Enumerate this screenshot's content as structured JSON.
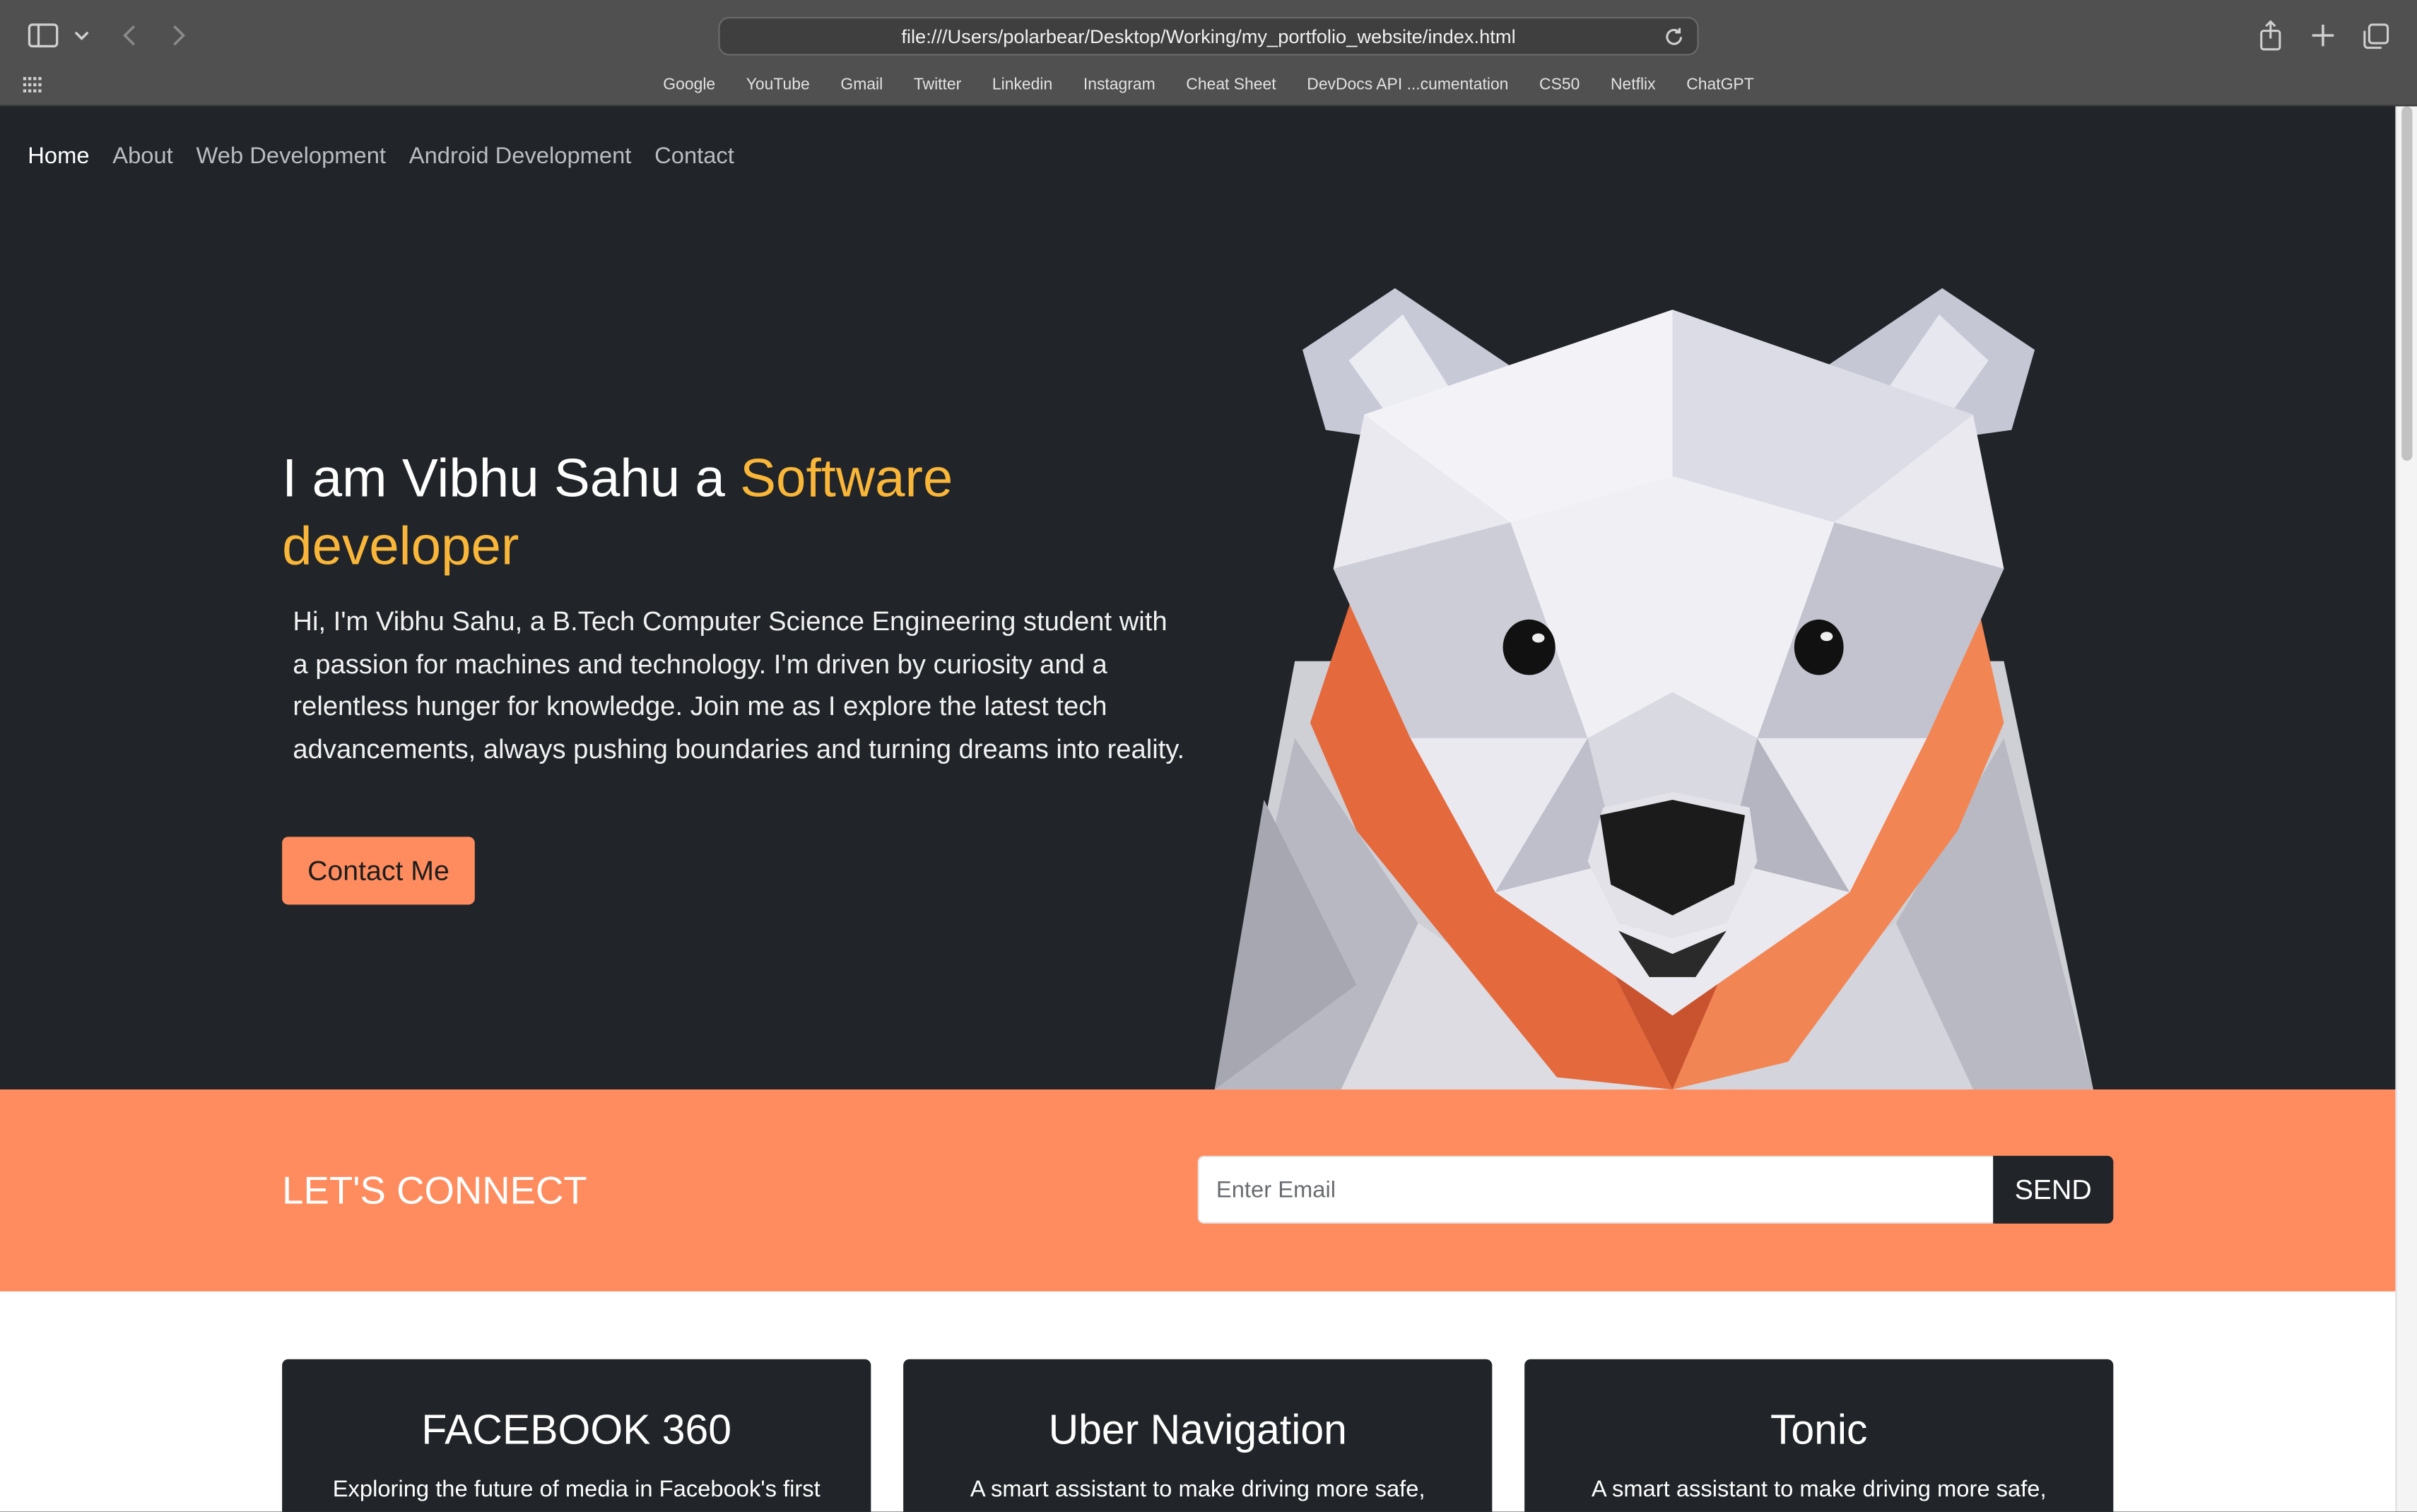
{
  "browser": {
    "url": "file:///Users/polarbear/Desktop/Working/my_portfolio_website/index.html",
    "icons": [
      "sidebar-icon",
      "chevron-down-icon",
      "back-icon",
      "forward-icon",
      "reload-icon",
      "share-icon",
      "plus-icon",
      "tabs-icon",
      "grid-icon"
    ],
    "bookmarks": [
      "Google",
      "YouTube",
      "Gmail",
      "Twitter",
      "Linkedin",
      "Instagram",
      "Cheat Sheet",
      "DevDocs API ...cumentation",
      "CS50",
      "Netflix",
      "ChatGPT"
    ]
  },
  "nav": {
    "items": [
      "Home",
      "About",
      "Web Development",
      "Android Development",
      "Contact"
    ],
    "active": "Home"
  },
  "hero": {
    "headline_prefix": "I am Vibhu Sahu a ",
    "headline_accent": "Software developer",
    "intro": "Hi, I'm Vibhu Sahu, a B.Tech Computer Science Engineering student with a passion for machines and technology. I'm driven by curiosity and a relentless hunger for knowledge. Join me as I explore the latest tech advancements, always pushing boundaries and turning dreams into reality.",
    "cta_label": "Contact Me",
    "image": "origami-polar-bear"
  },
  "connect": {
    "title": "LET'S CONNECT",
    "email_placeholder": "Enter Email",
    "send_label": "SEND"
  },
  "projects": [
    {
      "title": "FACEBOOK 360",
      "desc": "Exploring the future of media in Facebook's first"
    },
    {
      "title": "Uber Navigation",
      "desc": "A smart assistant to make driving more safe,"
    },
    {
      "title": "Tonic",
      "desc": "A smart assistant to make driving more safe,"
    }
  ],
  "colors": {
    "dark": "#212529",
    "accent_orange": "#ff8c5e",
    "accent_yellow": "#f9b639",
    "chrome": "#505050"
  }
}
